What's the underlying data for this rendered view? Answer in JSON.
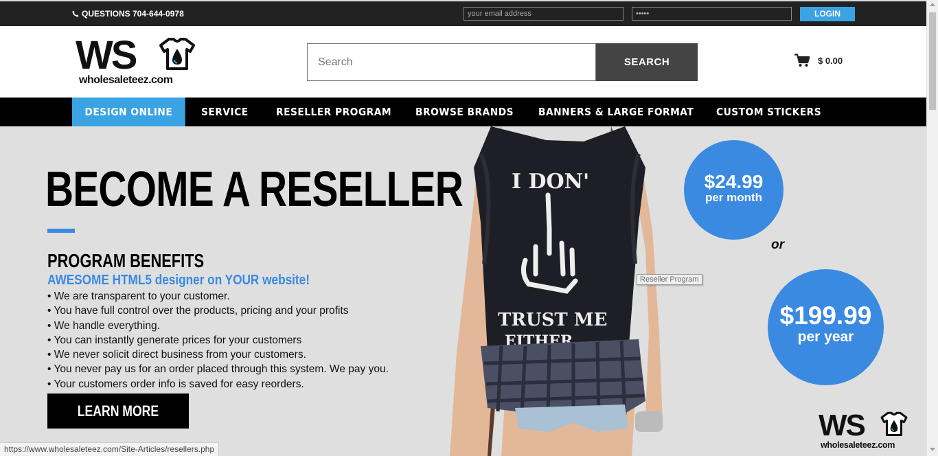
{
  "topbar": {
    "phone_text": "QUESTIONS 704-644-0978",
    "email_placeholder": "your email address",
    "password_value": "•••••",
    "login_label": "LOGIN"
  },
  "header": {
    "logo_letters": "WS",
    "logo_url": "wholesaleteez.com",
    "search_placeholder": "Search",
    "search_button": "SEARCH",
    "cart_total": "$ 0.00"
  },
  "nav": {
    "items": [
      "DESIGN ONLINE",
      "SERVICE",
      "RESELLER PROGRAM",
      "BROWSE BRANDS",
      "BANNERS & LARGE FORMAT",
      "CUSTOM STICKERS"
    ]
  },
  "hero": {
    "headline": "BECOME A RESELLER",
    "benefits_title": "PROGRAM BENEFITS",
    "benefits_subtitle": "AWESOME HTML5 designer on YOUR website!",
    "benefits": [
      "• We are transparent to your customer.",
      "• You have full control over the products, pricing and your profits",
      "• We handle everything.",
      "• You can instantly generate prices for your customers",
      "• We never solicit direct business from your customers.",
      "• You never pay us for an order placed through this system. We pay you.",
      "• Your customers order info is saved for easy reorders."
    ],
    "learn_more": "LEARN MORE",
    "shirt_text_top": "I DON'",
    "shirt_text_bottom_1": "TRUST ME",
    "shirt_text_bottom_2": "EITHER",
    "tooltip": "Reseller Program",
    "price_monthly": "$24.99",
    "price_monthly_period": "per month",
    "or_text": "or",
    "price_yearly": "$199.99",
    "price_yearly_period": "per year"
  },
  "status_bar": {
    "url": "https://www.wholesaleteez.com/Site-Articles/resellers.php"
  },
  "colors": {
    "accent_blue": "#3a8ae2",
    "nav_active": "#3aa3e3",
    "topbar_bg": "#222222",
    "hero_bg": "#dfdfdf"
  }
}
